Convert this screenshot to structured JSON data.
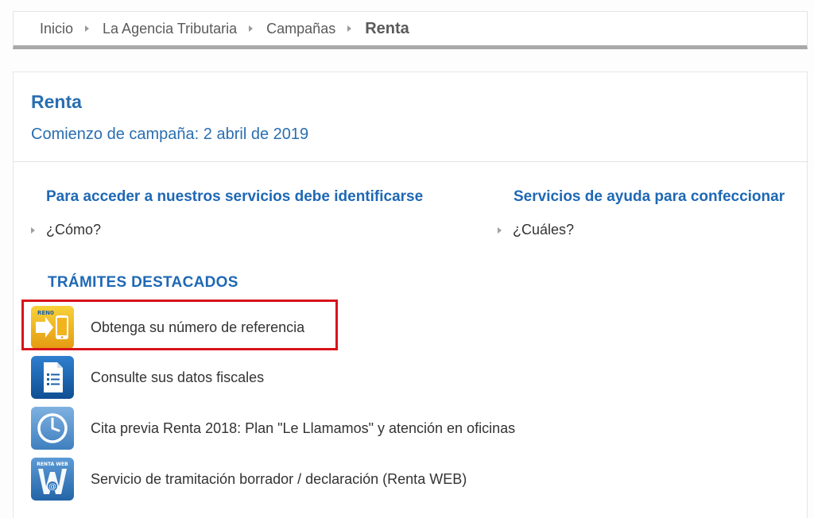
{
  "breadcrumb": {
    "items": [
      "Inicio",
      "La Agencia Tributaria",
      "Campañas"
    ],
    "current": "Renta"
  },
  "page": {
    "title": "Renta",
    "campaign_start": "Comienzo de campaña: 2 abril de 2019"
  },
  "sections": {
    "identify": {
      "heading": "Para acceder a nuestros servicios debe identificarse",
      "link": "¿Cómo?"
    },
    "help": {
      "heading": "Servicios de ayuda para confeccionar",
      "link": "¿Cuáles?"
    }
  },
  "featured": {
    "heading": "TRÁMITES DESTACADOS",
    "items": [
      {
        "label": "Obtenga su número de referencia",
        "icon": "mobile-reference-icon",
        "icon_text": "REN0",
        "highlighted": true
      },
      {
        "label": "Consulte sus datos fiscales",
        "icon": "fiscal-data-document-icon"
      },
      {
        "label": "Cita previa Renta 2018: Plan \"Le Llamamos\" y atención en oficinas",
        "icon": "clock-appointment-icon"
      },
      {
        "label": "Servicio de tramitación borrador / declaración (Renta WEB)",
        "icon": "renta-web-icon",
        "icon_text": "RENTA WEB"
      }
    ]
  },
  "colors": {
    "link_blue": "#1e68b4",
    "title_blue": "#2a6eb0",
    "highlight_red": "#d9131a",
    "text": "#333333",
    "breadcrumb_text": "#5a5a5a"
  }
}
